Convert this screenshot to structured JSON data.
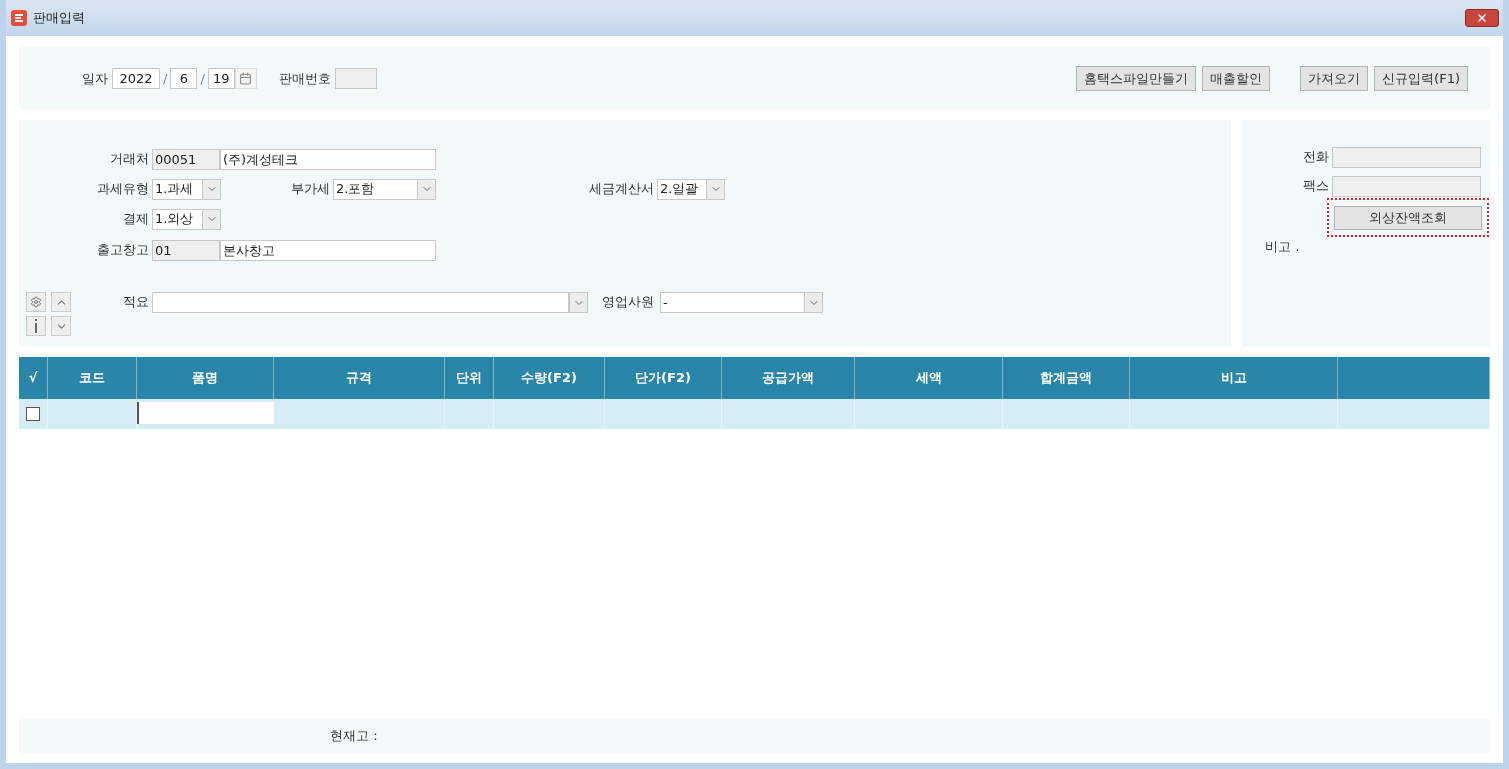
{
  "window": {
    "title": "판매입력"
  },
  "header": {
    "date_label": "일자",
    "date_parts": [
      "2022",
      "6",
      "19"
    ],
    "date_separators": [
      "/",
      "/"
    ],
    "number_label": "판매번호",
    "buttons": [
      {
        "label": "홈택스파일만들기"
      },
      {
        "label": "매출할인"
      },
      {
        "label": "가져오기"
      },
      {
        "label": "신규입력(F1)"
      }
    ]
  },
  "form": {
    "customer": {
      "label": "거래처",
      "code": "00051",
      "name": "(주)계성테크"
    },
    "tax_type": {
      "label": "과세유형",
      "value": "1.과세"
    },
    "vat": {
      "label": "부가세",
      "value": "2.포함"
    },
    "invoice": {
      "label": "세금계산서",
      "value": "2.일괄"
    },
    "payment": {
      "label": "결제",
      "value": "1.외상"
    },
    "warehouse": {
      "label": "출고창고",
      "code": "01",
      "name": "본사창고"
    },
    "summary": {
      "label": "적요"
    },
    "salesperson": {
      "label": "영업사원",
      "value": "-"
    }
  },
  "contact": {
    "phone_label": "전화",
    "fax_label": "팩스",
    "balance_button": {
      "label": "외상잔액조회",
      "highlighted": true
    },
    "memo_label": "비고 ."
  },
  "table": {
    "columns": [
      "√",
      "코드",
      "품명",
      "규격",
      "단위",
      "수량(F2)",
      "단가(F2)",
      "공급가액",
      "세액",
      "합계금액",
      "비고",
      ""
    ],
    "rows": [
      {
        "checked": false
      }
    ]
  },
  "footer": {
    "stock_label": "현재고 :"
  }
}
